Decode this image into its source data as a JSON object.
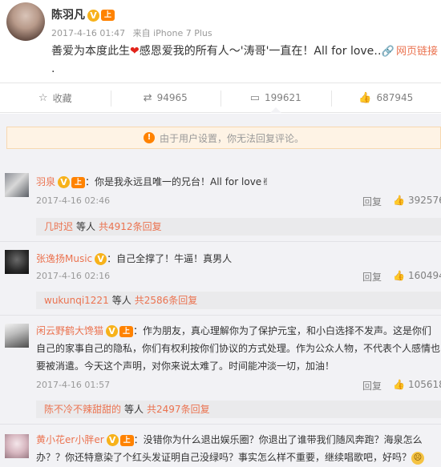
{
  "post": {
    "author": "陈羽凡",
    "verified_badge": "V",
    "vip_badge": "上",
    "time": "2017-4-16 01:47",
    "source": "来自 iPhone 7 Plus",
    "text_before_heart": "善爱为本度此生",
    "heart": "❤",
    "text_after_heart": "感恩爱我的所有人～'涛哥'一直在！All for love…",
    "web_link_label": "网页链接",
    "trailing": "."
  },
  "actions": [
    {
      "icon": "star-icon",
      "label": "收藏"
    },
    {
      "icon": "repost-icon",
      "label": "94965"
    },
    {
      "icon": "comment-icon",
      "label": "199621"
    },
    {
      "icon": "like-icon",
      "label": "687945"
    }
  ],
  "notice": "由于用户设置，你无法回复评论。",
  "comments": [
    {
      "name": "羽泉",
      "text": "：你是我永远且唯一的兄台！All for love",
      "emoji": "✌",
      "time": "2017-4-16 02:46",
      "reply": "回复",
      "likes": "392576",
      "sub_user": "几时迟",
      "sub_text": "等人",
      "sub_count": "共4912条回复"
    },
    {
      "name": "张逸扬Music",
      "text": "：自己全撑了！牛逼！真男人",
      "time": "2017-4-16 02:16",
      "reply": "回复",
      "likes": "160494",
      "sub_user": "wukunqi1221",
      "sub_text": "等人",
      "sub_count": "共2586条回复"
    },
    {
      "name": "闲云野鹤大馋猫",
      "text": "：作为朋友，真心理解你为了保护元宝，和小白选择不发声。这是你们自己的家事自己的隐私，你们有权利按你们协议的方式处理。作为公众人物，不代表个人感情也要被消遣。今天这个声明，对你来说太难了。时间能冲淡一切，加油！",
      "time": "2017-4-16 01:57",
      "reply": "回复",
      "likes": "105618",
      "sub_user": "陈不冷不辣甜甜的",
      "sub_text": "等人",
      "sub_count": "共2497条回复"
    },
    {
      "name": "黄小花er小胖er",
      "text": "：没错你为什么退出娱乐圈？你退出了谁带我们随风奔跑？海泉怎么办？？你还特意染了个红头发证明自己没绿吗？事实怎么样不重要，继续唱歌吧，好吗？",
      "emoji": "☹"
    }
  ],
  "colors": {
    "link": "#eb7350",
    "badge_v": "#f7b21a",
    "badge_vip": "#ff8200",
    "comment_bg": "#f2f2f5"
  }
}
